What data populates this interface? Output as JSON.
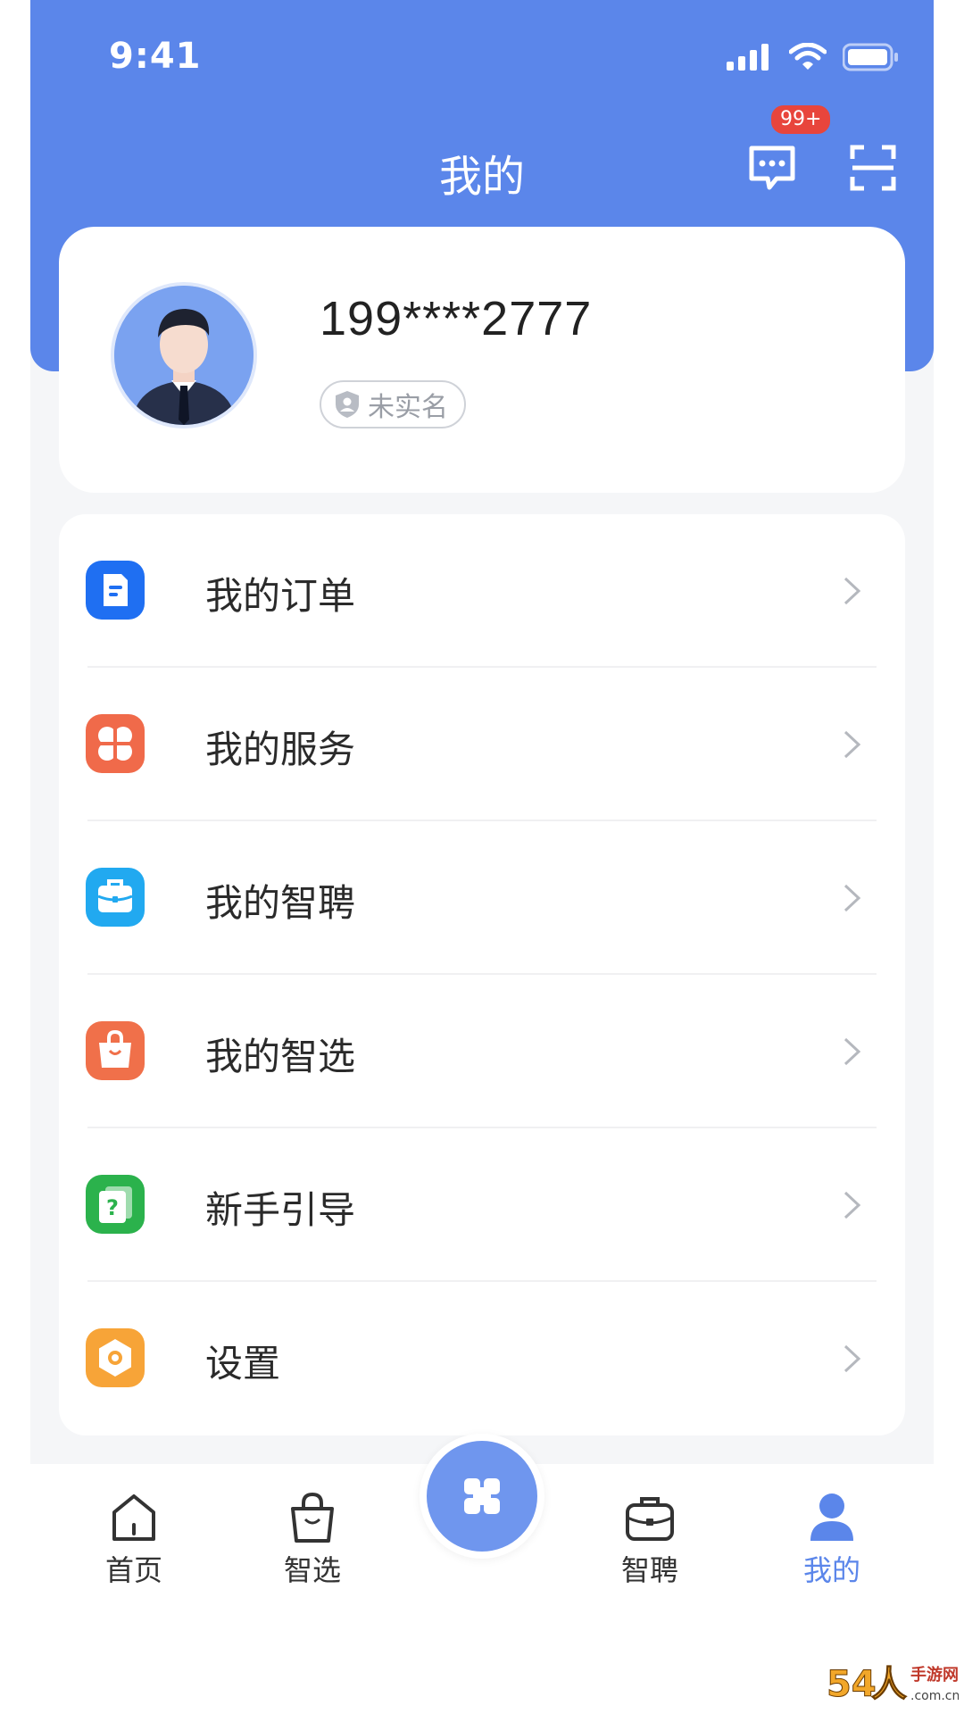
{
  "status_bar": {
    "time": "9:41"
  },
  "header": {
    "title": "我的",
    "message_badge": "99+"
  },
  "profile": {
    "phone": "199****2777",
    "verify_status": "未实名"
  },
  "menu": {
    "items": [
      {
        "label": "我的订单",
        "icon": "order-icon",
        "color": "#1f6ff2"
      },
      {
        "label": "我的服务",
        "icon": "service-grid-icon",
        "color": "#f06a4a"
      },
      {
        "label": "我的智聘",
        "icon": "briefcase-icon",
        "color": "#21a9f0"
      },
      {
        "label": "我的智选",
        "icon": "shopping-bag-icon",
        "color": "#f0704a"
      },
      {
        "label": "新手引导",
        "icon": "help-card-icon",
        "color": "#2bb24c"
      },
      {
        "label": "设置",
        "icon": "settings-hexagon-icon",
        "color": "#f7a438"
      }
    ]
  },
  "tabbar": {
    "items": [
      {
        "label": "首页",
        "icon": "home-icon"
      },
      {
        "label": "智选",
        "icon": "shopping-bag-icon"
      },
      {
        "label": "智聘",
        "icon": "briefcase-icon"
      },
      {
        "label": "我的",
        "icon": "user-icon",
        "active": true
      }
    ],
    "center_icon": "app-hub-icon"
  },
  "colors": {
    "primary": "#5b86ea",
    "badge": "#e8453c"
  },
  "watermark": "54人游手游网 .com.cn"
}
